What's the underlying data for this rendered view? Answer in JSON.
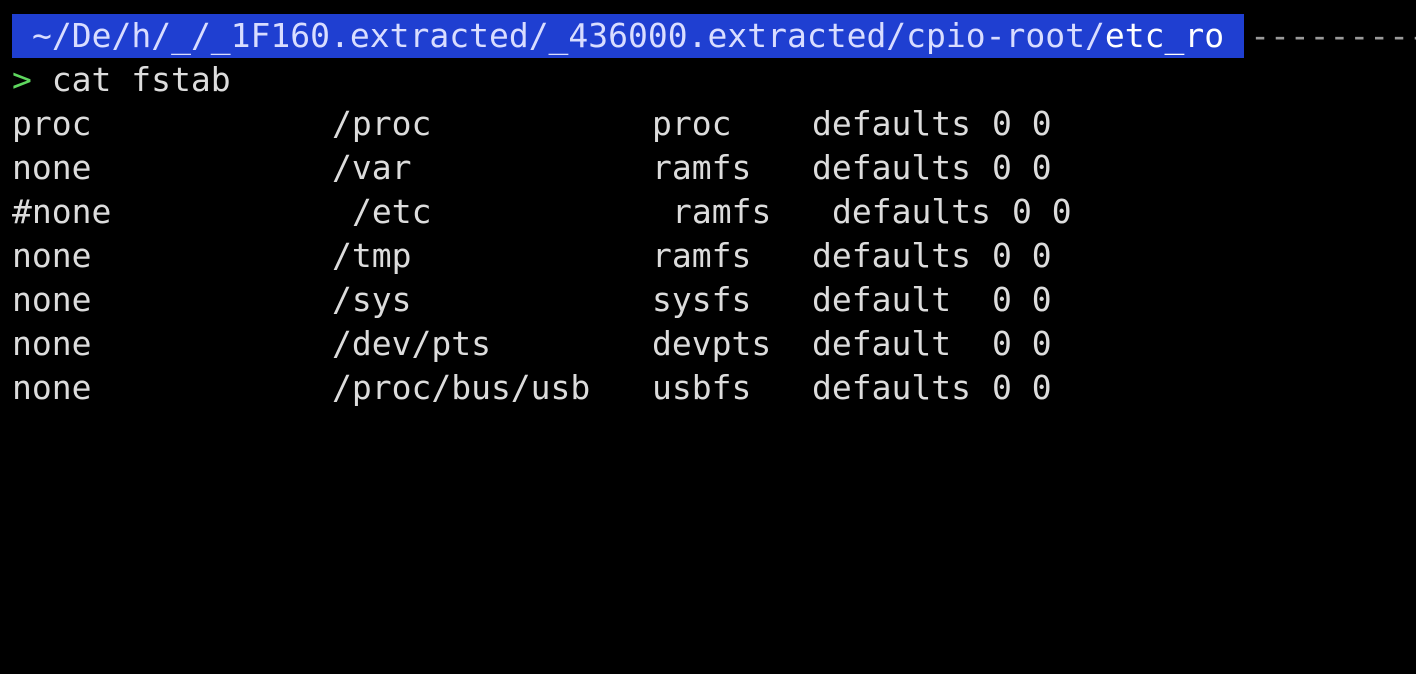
{
  "prompt": {
    "path_prefix": "~/De/h/_/_1F160.extracted/_436000.extracted/cpio-root/",
    "cwd": "etc_ro",
    "dashes": "---------",
    "prompt_char": ">",
    "command": "cat fstab"
  },
  "colors": {
    "background": "#000000",
    "text": "#dcdcdc",
    "path_highlight": "#1f3fd1",
    "prompt_char": "#5fd75f",
    "dashes": "#9a9a9a"
  },
  "fstab": {
    "rows": [
      {
        "device": "proc",
        "mount": "/proc",
        "type": "proc",
        "options": "defaults",
        "dump_pass": "0 0",
        "shifted": false
      },
      {
        "device": "none",
        "mount": "/var",
        "type": "ramfs",
        "options": "defaults",
        "dump_pass": "0 0",
        "shifted": false
      },
      {
        "device": "#none",
        "mount": "/etc",
        "type": "ramfs",
        "options": "defaults",
        "dump_pass": "0 0",
        "shifted": true
      },
      {
        "device": "none",
        "mount": "/tmp",
        "type": "ramfs",
        "options": "defaults",
        "dump_pass": "0 0",
        "shifted": false
      },
      {
        "device": "none",
        "mount": "/sys",
        "type": "sysfs",
        "options": "default",
        "dump_pass": "0 0",
        "shifted": false
      },
      {
        "device": "none",
        "mount": "/dev/pts",
        "type": "devpts",
        "options": "default",
        "dump_pass": "0 0",
        "shifted": false
      },
      {
        "device": "none",
        "mount": "/proc/bus/usb",
        "type": "usbfs",
        "options": "defaults",
        "dump_pass": "0 0",
        "shifted": false
      }
    ]
  }
}
